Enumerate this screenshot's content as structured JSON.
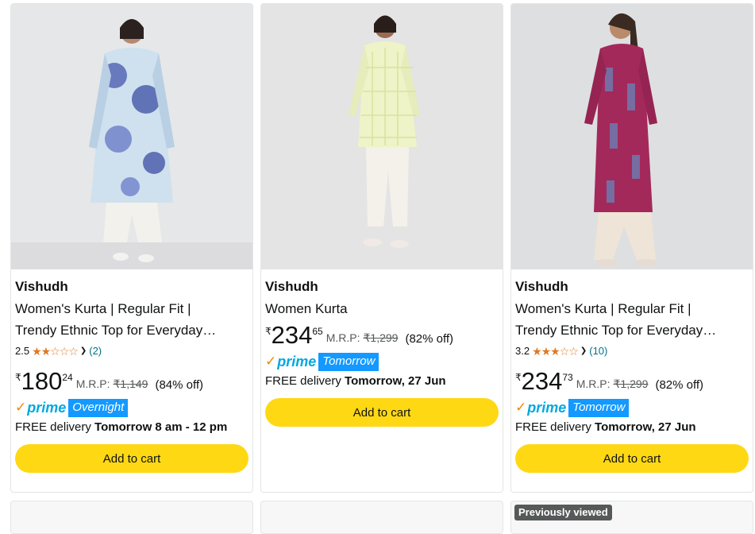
{
  "products": [
    {
      "brand": "Vishudh",
      "title_line1": "Women's Kurta | Regular Fit |",
      "title_line2": "Trendy Ethnic Top for Everyday…",
      "rating": "2.5",
      "rating_value": 2.5,
      "stars": "★★☆☆☆",
      "review_count": "(2)",
      "currency": "₹",
      "price_whole": "180",
      "price_fraction": "24",
      "mrp_label": "M.R.P:",
      "mrp": "₹1,149",
      "discount": "(84% off)",
      "prime_label": "prime",
      "prime_badge": "Overnight",
      "delivery_prefix": "FREE delivery ",
      "delivery_when": "Tomorrow 8 am - 12 pm",
      "add_to_cart": "Add to cart",
      "image_icon": "kurta-blue-floral-photo"
    },
    {
      "brand": "Vishudh",
      "title_line1": "Women Kurta",
      "currency": "₹",
      "price_whole": "234",
      "price_fraction": "65",
      "mrp_label": "M.R.P:",
      "mrp": "₹1,299",
      "discount": "(82% off)",
      "prime_label": "prime",
      "prime_badge": "Tomorrow",
      "delivery_prefix": "FREE delivery ",
      "delivery_when": "Tomorrow, 27 Jun",
      "add_to_cart": "Add to cart",
      "image_icon": "kurta-lime-print-photo"
    },
    {
      "brand": "Vishudh",
      "title_line1": "Women's Kurta | Regular Fit |",
      "title_line2": "Trendy Ethnic Top for Everyday…",
      "rating": "3.2",
      "rating_value": 3.2,
      "stars": "★★★☆☆",
      "review_count": "(10)",
      "currency": "₹",
      "price_whole": "234",
      "price_fraction": "73",
      "mrp_label": "M.R.P:",
      "mrp": "₹1,299",
      "discount": "(82% off)",
      "prime_label": "prime",
      "prime_badge": "Tomorrow",
      "delivery_prefix": "FREE delivery ",
      "delivery_when": "Tomorrow, 27 Jun",
      "add_to_cart": "Add to cart",
      "image_icon": "kurta-maroon-ikat-photo"
    }
  ],
  "previously_viewed_label": "Previously viewed",
  "colors": {
    "cart_button": "#ffd814",
    "prime_badge": "#1399ff",
    "star": "#de7921",
    "link": "#007185"
  }
}
